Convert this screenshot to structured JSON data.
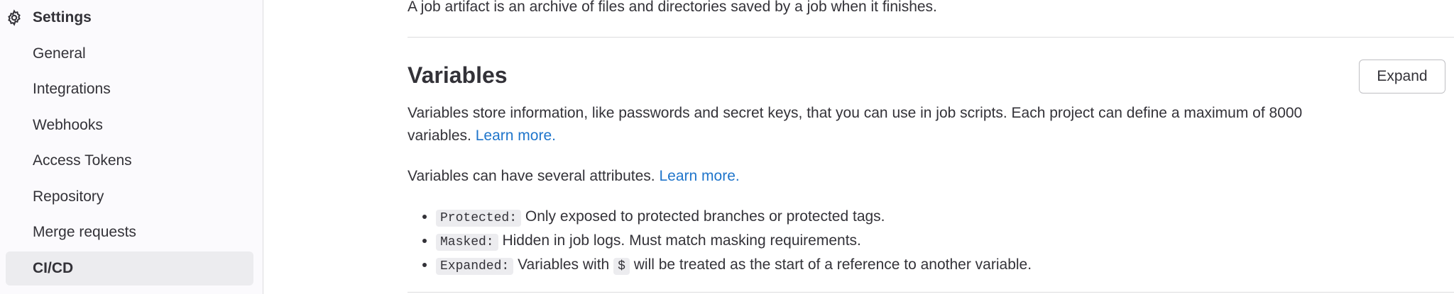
{
  "sidebar": {
    "header": "Settings",
    "items": [
      {
        "label": "General"
      },
      {
        "label": "Integrations"
      },
      {
        "label": "Webhooks"
      },
      {
        "label": "Access Tokens"
      },
      {
        "label": "Repository"
      },
      {
        "label": "Merge requests"
      },
      {
        "label": "CI/CD",
        "active": true
      }
    ]
  },
  "artifacts": {
    "description": "A job artifact is an archive of files and directories saved by a job when it finishes."
  },
  "variables": {
    "title": "Variables",
    "expand_label": "Expand",
    "description": "Variables store information, like passwords and secret keys, that you can use in job scripts. Each project can define a maximum of 8000 variables.",
    "learn_more_1": "Learn more.",
    "attributes_intro": "Variables can have several attributes.",
    "learn_more_2": "Learn more.",
    "attributes": [
      {
        "name": "Protected:",
        "text": "Only exposed to protected branches or protected tags."
      },
      {
        "name": "Masked:",
        "text": "Hidden in job logs. Must match masking requirements."
      },
      {
        "name": "Expanded:",
        "text_before": "Variables with",
        "symbol": "$",
        "text_after": "will be treated as the start of a reference to another variable."
      }
    ]
  }
}
